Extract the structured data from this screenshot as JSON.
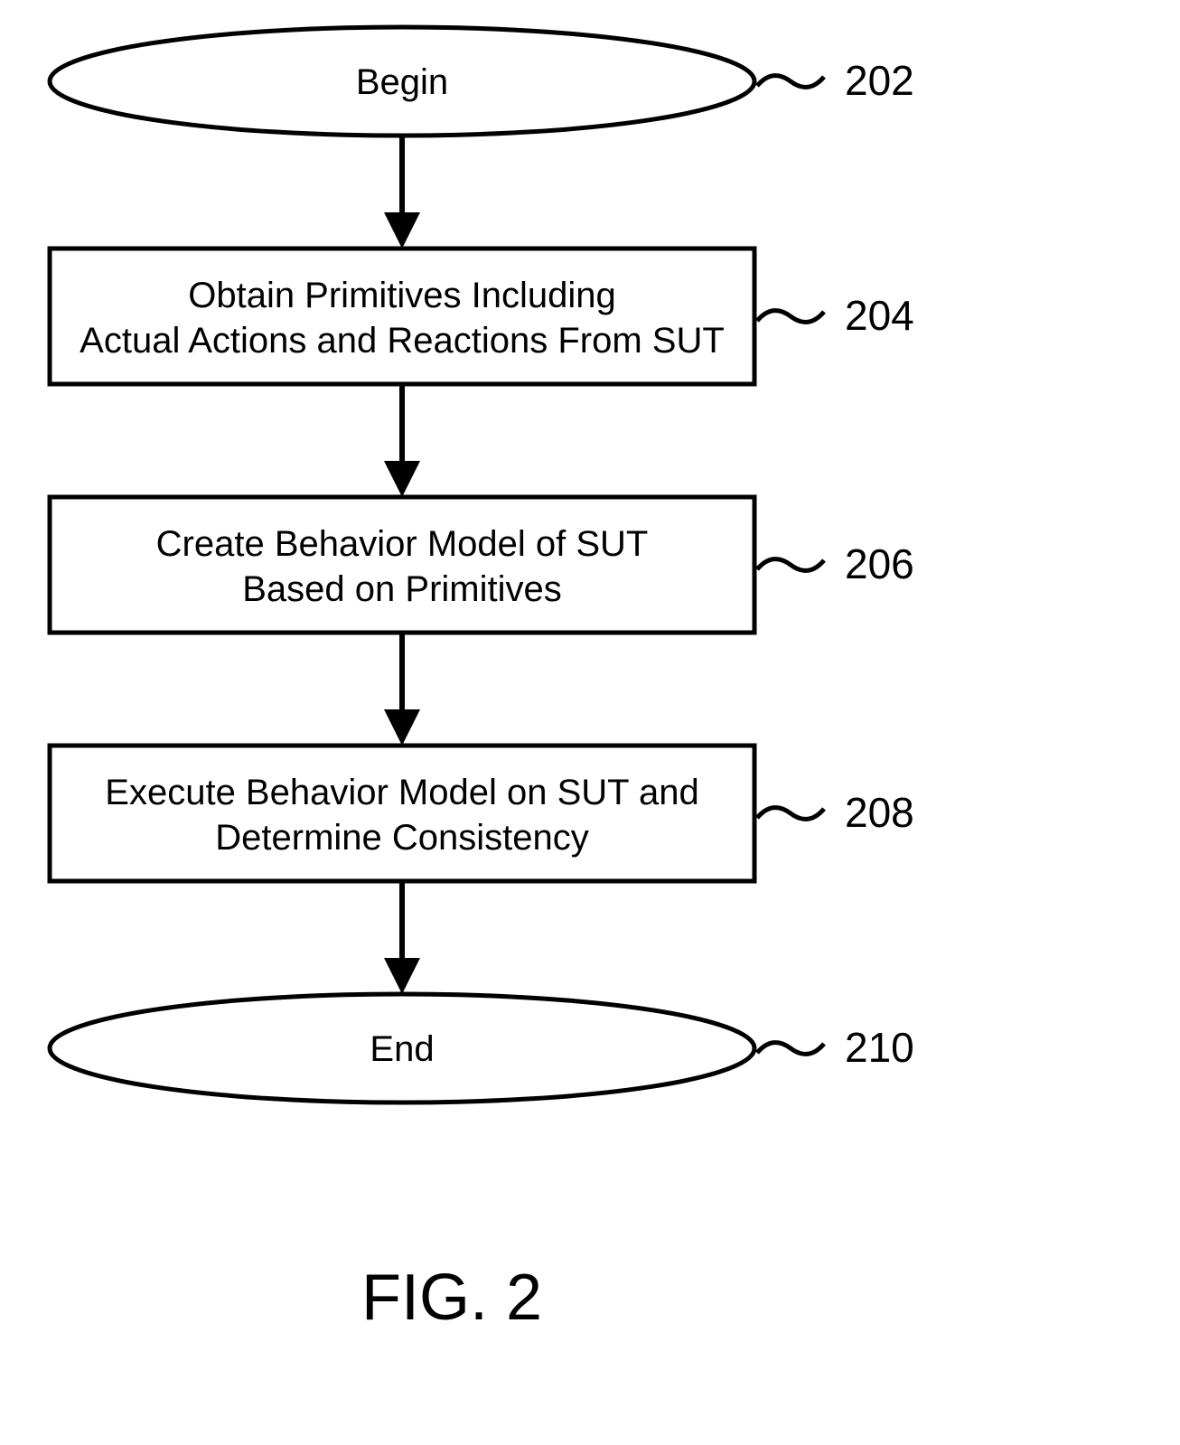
{
  "flowchart": {
    "nodes": {
      "begin": {
        "label": "Begin",
        "ref": "202"
      },
      "obtain": {
        "line1": "Obtain Primitives Including",
        "line2": "Actual Actions and Reactions From SUT",
        "ref": "204"
      },
      "create": {
        "line1": "Create Behavior Model of SUT",
        "line2": "Based on Primitives",
        "ref": "206"
      },
      "execute": {
        "line1": "Execute Behavior Model on SUT and",
        "line2": "Determine Consistency",
        "ref": "208"
      },
      "end": {
        "label": "End",
        "ref": "210"
      }
    },
    "caption": "FIG. 2"
  }
}
